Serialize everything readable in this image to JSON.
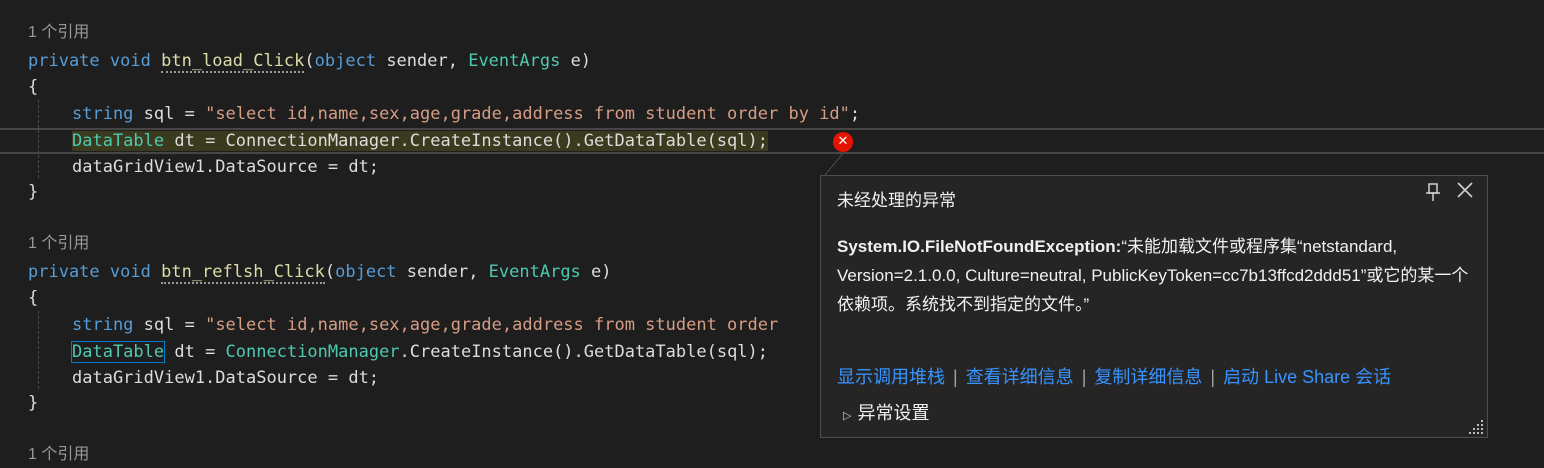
{
  "codelens": {
    "references": "1 个引用"
  },
  "method1": {
    "kw_private": "private",
    "kw_void": "void",
    "name": "btn_load_Click",
    "paren_open": "(",
    "kw_object": "object",
    "param_sender": " sender, ",
    "type_eventargs": "EventArgs",
    "param_e": " e)",
    "brace_open": "{",
    "brace_close": "}",
    "line1_kw": "string",
    "line1_var": " sql = ",
    "line1_str": "\"select id,name,sex,age,grade,address from student order by id\"",
    "line1_end": ";",
    "line2_type": "DataTable",
    "line2_rest": " dt = ConnectionManager.CreateInstance().GetDataTable(sql);",
    "line3": "dataGridView1.DataSource = dt;"
  },
  "method2": {
    "kw_private": "private",
    "kw_void": "void",
    "name": "btn_reflsh_Click",
    "paren_open": "(",
    "kw_object": "object",
    "param_sender": " sender, ",
    "type_eventargs": "EventArgs",
    "param_e": " e)",
    "brace_open": "{",
    "brace_close": "}",
    "line1_kw": "string",
    "line1_var": " sql = ",
    "line1_str": "\"select id,name,sex,age,grade,address from student order",
    "line2_type": "DataTable",
    "line2_dt": " dt = ",
    "line2_class": "ConnectionManager",
    "line2_rest": ".CreateInstance().GetDataTable(sql);",
    "line3": "dataGridView1.DataSource = dt;"
  },
  "error_glyph": "✕",
  "exception_popup": {
    "title": "未经处理的异常",
    "pin_icon": "pin-icon",
    "close_icon": "close-icon",
    "exception_type": "System.IO.FileNotFoundException:",
    "message": "“未能加载文件或程序集“netstandard, Version=2.1.0.0, Culture=neutral, PublicKeyToken=cc7b13ffcd2ddd51”或它的某一个依赖项。系统找不到指定的文件。”",
    "links": [
      "显示调用堆栈",
      "查看详细信息",
      "复制详细信息",
      "启动 Live Share 会话"
    ],
    "link_separator": "|",
    "settings_label": "异常设置",
    "settings_arrow": "▷"
  },
  "colors": {
    "background": "#1e1e1e",
    "keyword": "#569cd6",
    "type": "#4ec9b0",
    "string": "#d69d85",
    "link": "#3794ff",
    "error": "#e51400"
  }
}
